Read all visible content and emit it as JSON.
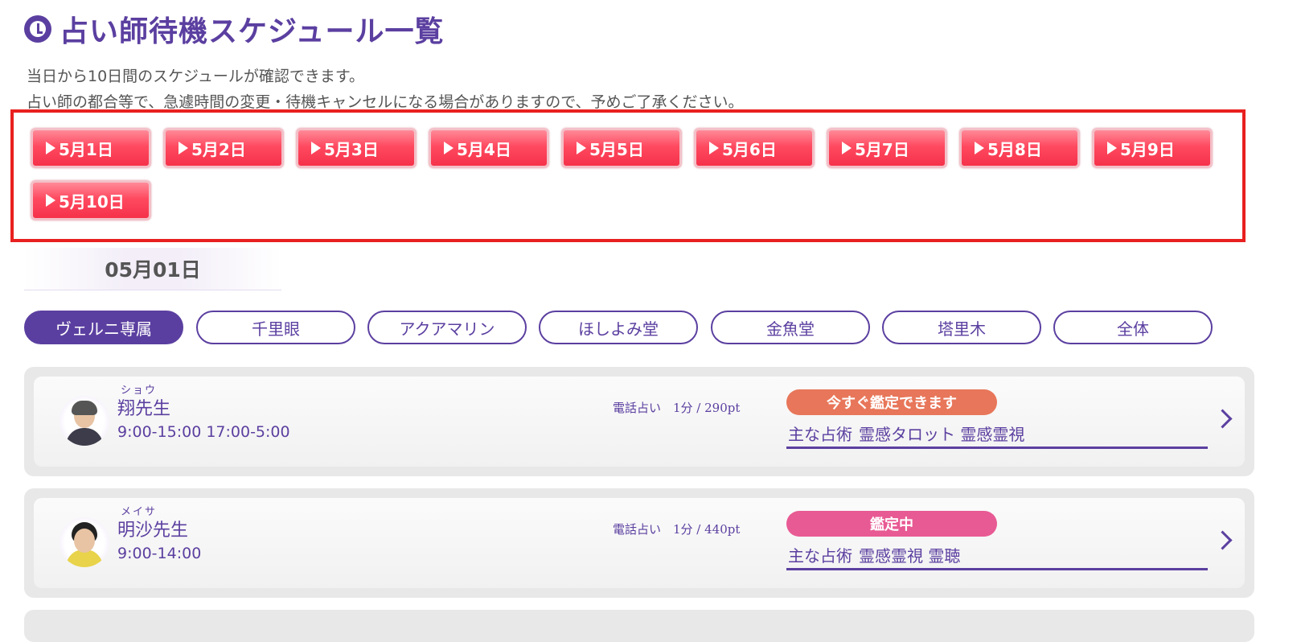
{
  "page": {
    "title": "占い師待機スケジュール一覧",
    "description_line1": "当日から10日間のスケジュールが確認できます。",
    "description_line2": "占い師の都合等で、急遽時間の変更・待機キャンセルになる場合がありますので、予めご了承ください。"
  },
  "date_tabs": [
    "5月1日",
    "5月2日",
    "5月3日",
    "5月4日",
    "5月5日",
    "5月6日",
    "5月7日",
    "5月8日",
    "5月9日",
    "5月10日"
  ],
  "selected_date": "05月01日",
  "categories": [
    "ヴェルニ専属",
    "千里眼",
    "アクアマリン",
    "ほしよみ堂",
    "金魚堂",
    "塔里木",
    "全体"
  ],
  "active_category": "ヴェルニ専属",
  "fortune_tellers": [
    {
      "ruby": "ショウ",
      "name": "翔先生",
      "hours": "9:00-15:00 17:00-5:00",
      "price": "電話占い　1分 / 290pt",
      "status": "今すぐ鑑定できます",
      "status_color": "#e8765a",
      "methods_label": "主な占術",
      "methods": "霊感タロット 霊感霊視"
    },
    {
      "ruby": "メイサ",
      "name": "明沙先生",
      "hours": "9:00-14:00",
      "price": "電話占い　1分 / 440pt",
      "status": "鑑定中",
      "status_color": "#e85a94",
      "methods_label": "主な占術",
      "methods": "霊感霊視 霊聴"
    }
  ],
  "icons": {
    "title_icon": "clock-icon",
    "date_tab_icon": "play-triangle-icon",
    "card_arrow": "chevron-right-icon"
  },
  "colors": {
    "brand_purple": "#5b3fa0",
    "date_button_red": "#f5324a",
    "highlight_border": "#e8201f"
  }
}
